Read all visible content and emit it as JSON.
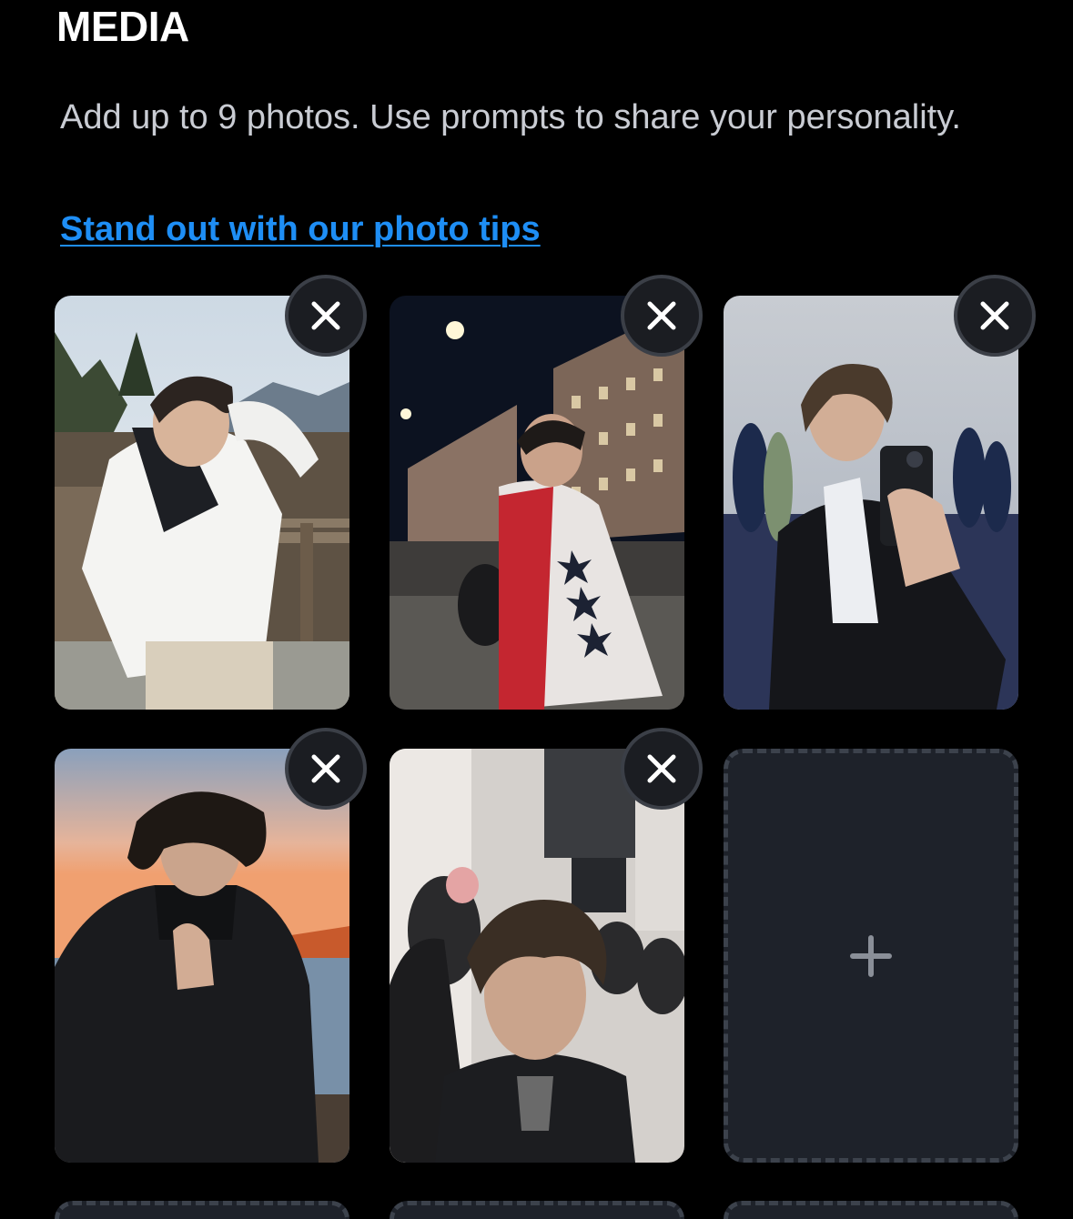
{
  "media": {
    "title": "MEDIA",
    "description": "Add up to 9 photos. Use prompts to share your personality.",
    "tips_link": "Stand out with our photo tips",
    "photos": [
      {
        "slot": 1,
        "filled": true,
        "remove_icon": "close-icon"
      },
      {
        "slot": 2,
        "filled": true,
        "remove_icon": "close-icon"
      },
      {
        "slot": 3,
        "filled": true,
        "remove_icon": "close-icon"
      },
      {
        "slot": 4,
        "filled": true,
        "remove_icon": "close-icon"
      },
      {
        "slot": 5,
        "filled": true,
        "remove_icon": "close-icon"
      },
      {
        "slot": 6,
        "filled": false,
        "add_icon": "plus-icon"
      },
      {
        "slot": 7,
        "filled": false
      },
      {
        "slot": 8,
        "filled": false
      },
      {
        "slot": 9,
        "filled": false
      }
    ]
  },
  "colors": {
    "background": "#000000",
    "link": "#1e8ef5",
    "empty_slot": "#1e222a",
    "remove_button": "#1b1d22"
  }
}
